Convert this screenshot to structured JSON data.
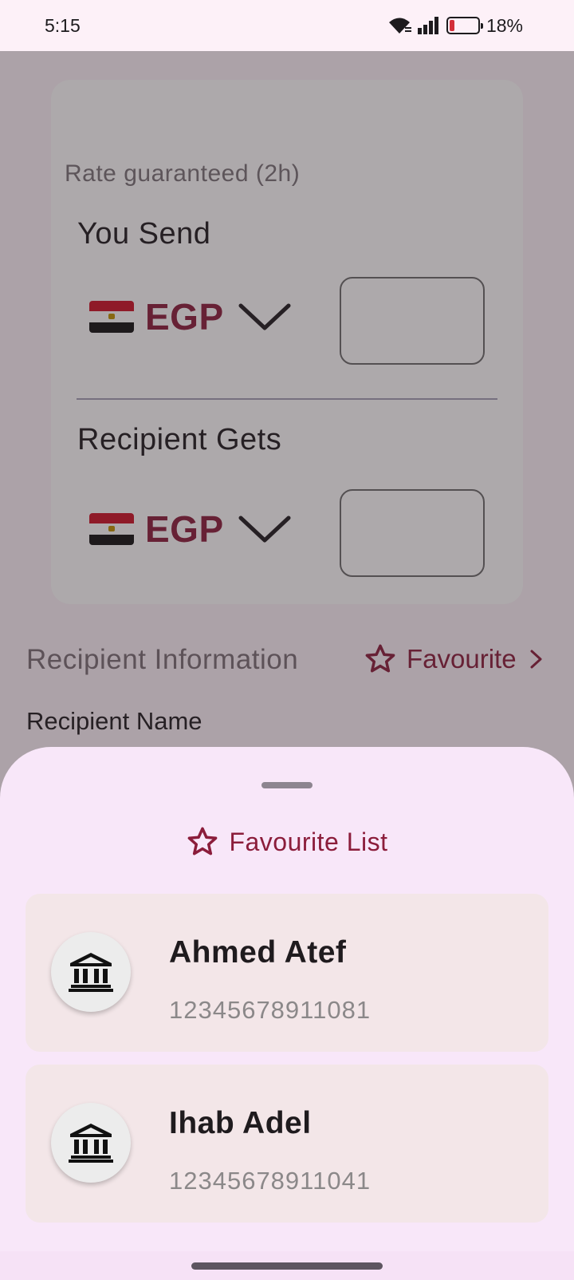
{
  "status_bar": {
    "time": "5:15",
    "battery_percent": "18%",
    "battery_level": 0.18,
    "icons": [
      "wifi-icon",
      "signal-icon",
      "battery-icon"
    ]
  },
  "exchange_card": {
    "rate_text": "Rate guaranteed (2h)",
    "send": {
      "label": "You Send",
      "currency": "EGP",
      "flag": "egypt-flag-icon",
      "amount": ""
    },
    "receive": {
      "label": "Recipient Gets",
      "currency": "EGP",
      "flag": "egypt-flag-icon",
      "amount": ""
    }
  },
  "recipient": {
    "section_title": "Recipient Information",
    "favourite_link": "Favourite",
    "name_label": "Recipient Name"
  },
  "favourite_sheet": {
    "title": "Favourite List",
    "items": [
      {
        "name": "Ahmed Atef",
        "account": "12345678911081",
        "icon": "bank-icon"
      },
      {
        "name": "Ihab Adel",
        "account": "12345678911041",
        "icon": "bank-icon"
      }
    ]
  },
  "colors": {
    "accent": "#8b1d3b",
    "sheet_background": "#f8e7f9",
    "item_background": "#f3e6e8"
  }
}
